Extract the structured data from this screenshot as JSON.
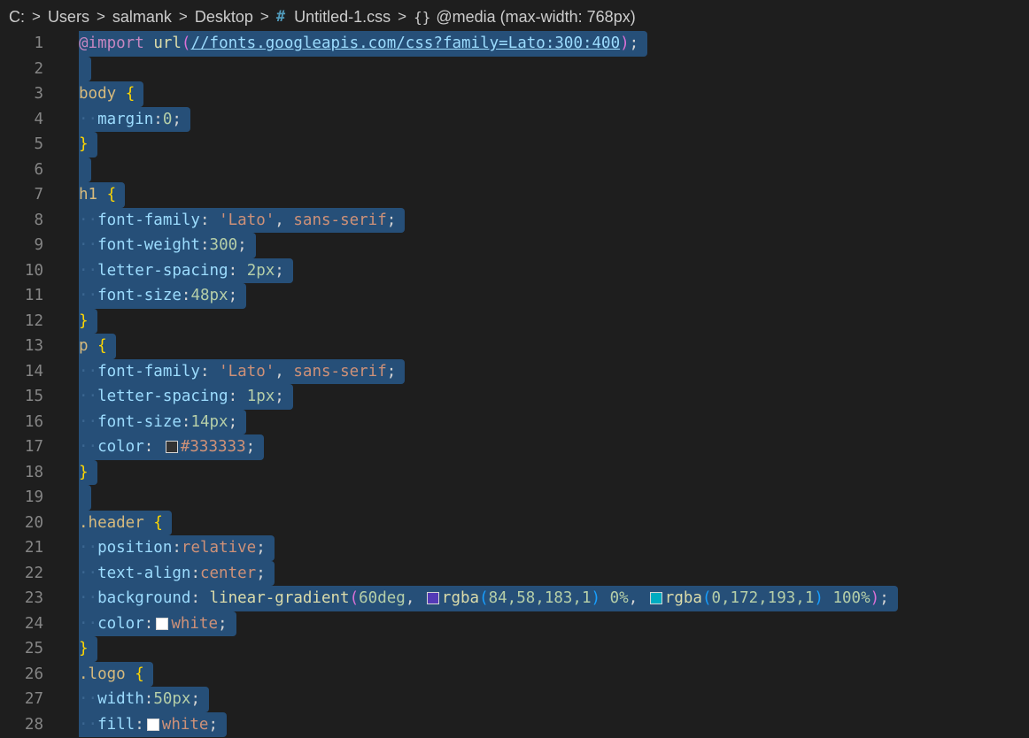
{
  "breadcrumb": {
    "drive": "C:",
    "folder1": "Users",
    "folder2": "salmank",
    "folder3": "Desktop",
    "file_icon": "#",
    "file": "Untitled-1.css",
    "symbol_icon": "{}",
    "symbol": "@media (max-width: 768px)"
  },
  "colors": {
    "swatch_333": "#333333",
    "swatch_purple": "#543ab7",
    "swatch_teal": "#00acc1",
    "swatch_white": "#ffffff"
  },
  "code": {
    "l1": {
      "num": "1",
      "at": "@import",
      "fn": "url",
      "open": "(",
      "url": "//fonts.googleapis.com/css?family=Lato:300:400",
      "close": ")",
      "semi": ";"
    },
    "l2": {
      "num": "2"
    },
    "l3": {
      "num": "3",
      "sel": "body",
      "brace": "{"
    },
    "l4": {
      "num": "4",
      "prop": "margin",
      "colon": ":",
      "val": "0",
      "semi": ";"
    },
    "l5": {
      "num": "5",
      "brace": "}"
    },
    "l6": {
      "num": "6"
    },
    "l7": {
      "num": "7",
      "sel": "h1",
      "brace": "{"
    },
    "l8": {
      "num": "8",
      "prop": "font-family",
      "colon": ":",
      "str": "'Lato'",
      "comma": ",",
      "val": "sans-serif",
      "semi": ";"
    },
    "l9": {
      "num": "9",
      "prop": "font-weight",
      "colon": ":",
      "val": "300",
      "semi": ";"
    },
    "l10": {
      "num": "10",
      "prop": "letter-spacing",
      "colon": ":",
      "val": "2px",
      "semi": ";"
    },
    "l11": {
      "num": "11",
      "prop": "font-size",
      "colon": ":",
      "val": "48px",
      "semi": ";"
    },
    "l12": {
      "num": "12",
      "brace": "}"
    },
    "l13": {
      "num": "13",
      "sel": "p",
      "brace": "{"
    },
    "l14": {
      "num": "14",
      "prop": "font-family",
      "colon": ":",
      "str": "'Lato'",
      "comma": ",",
      "val": "sans-serif",
      "semi": ";"
    },
    "l15": {
      "num": "15",
      "prop": "letter-spacing",
      "colon": ":",
      "val": "1px",
      "semi": ";"
    },
    "l16": {
      "num": "16",
      "prop": "font-size",
      "colon": ":",
      "val": "14px",
      "semi": ";"
    },
    "l17": {
      "num": "17",
      "prop": "color",
      "colon": ":",
      "val": "#333333",
      "semi": ";"
    },
    "l18": {
      "num": "18",
      "brace": "}"
    },
    "l19": {
      "num": "19"
    },
    "l20": {
      "num": "20",
      "sel": ".header",
      "brace": "{"
    },
    "l21": {
      "num": "21",
      "prop": "position",
      "colon": ":",
      "val": "relative",
      "semi": ";"
    },
    "l22": {
      "num": "22",
      "prop": "text-align",
      "colon": ":",
      "val": "center",
      "semi": ";"
    },
    "l23": {
      "num": "23",
      "prop": "background",
      "colon": ":",
      "fn": "linear-gradient",
      "open": "(",
      "deg": "60deg",
      "comma": ",",
      "rgba1_fn": "rgba",
      "rgba1_open": "(",
      "rgba1_args": "84,58,183,1",
      "rgba1_close": ")",
      "stop1": "0%",
      "rgba2_fn": "rgba",
      "rgba2_open": "(",
      "rgba2_args": "0,172,193,1",
      "rgba2_close": ")",
      "stop2": "100%",
      "close": ")",
      "semi": ";"
    },
    "l24": {
      "num": "24",
      "prop": "color",
      "colon": ":",
      "val": "white",
      "semi": ";"
    },
    "l25": {
      "num": "25",
      "brace": "}"
    },
    "l26": {
      "num": "26",
      "sel": ".logo",
      "brace": "{"
    },
    "l27": {
      "num": "27",
      "prop": "width",
      "colon": ":",
      "val": "50px",
      "semi": ";"
    },
    "l28": {
      "num": "28",
      "prop": "fill",
      "colon": ":",
      "val": "white",
      "semi": ";"
    }
  }
}
